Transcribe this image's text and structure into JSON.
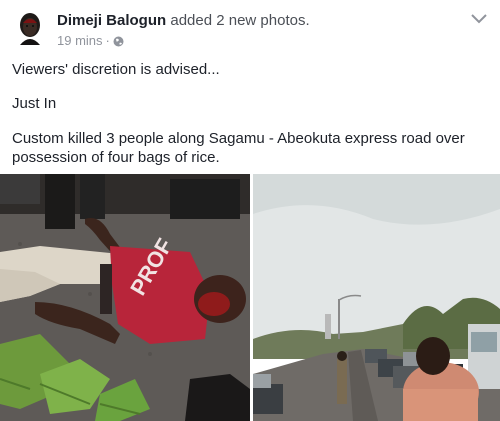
{
  "post": {
    "author": "Dimeji Balogun",
    "action": "added 2 new photos.",
    "timestamp": "19 mins",
    "separator": "·",
    "privacy_icon": "globe-icon",
    "menu_icon": "chevron-down-icon",
    "paragraphs": {
      "p1": "Viewers' discretion is advised...",
      "p2": "Just In",
      "p3": "Custom killed 3 people along Sagamu - Abeokuta express road over possession of four bags of rice."
    },
    "photos": {
      "photo_1": {
        "shirt_text": "PROF"
      },
      "photo_2": {}
    }
  },
  "colors": {
    "name": "#1d2129",
    "meta": "#90949c",
    "shirt": "#b8253a",
    "road": "#6f6b67",
    "sky": "#e2e6e6"
  }
}
